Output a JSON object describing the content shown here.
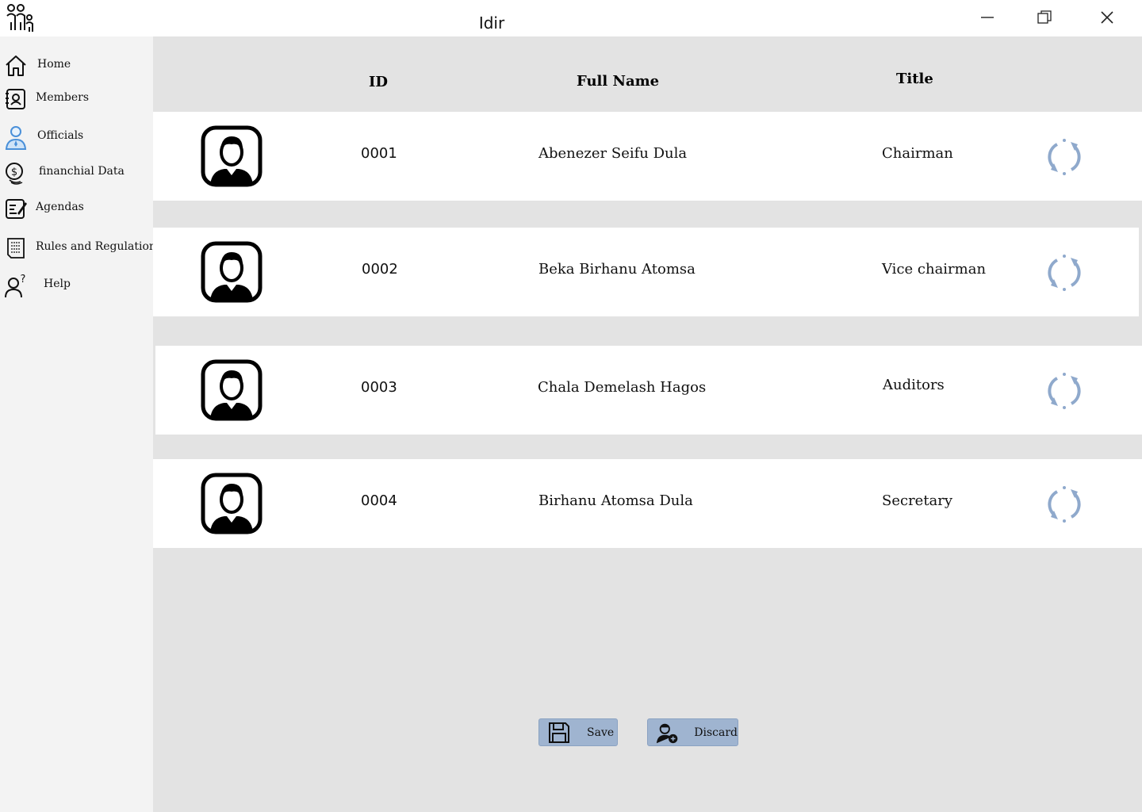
{
  "window": {
    "title": "Idir",
    "icons": {
      "logo": "family-icon",
      "minimize": "minimize-icon",
      "maximize": "maximize-icon",
      "close": "close-icon"
    }
  },
  "sidebar": {
    "items": [
      {
        "label": "Home",
        "icon": "home-icon"
      },
      {
        "label": "Members",
        "icon": "members-book-icon"
      },
      {
        "label": "Officials",
        "icon": "official-person-icon"
      },
      {
        "label": "financhial Data",
        "icon": "coins-icon"
      },
      {
        "label": "Agendas",
        "icon": "notepad-icon"
      },
      {
        "label": "Rules and Regulations",
        "icon": "document-icon"
      },
      {
        "label": "Help",
        "icon": "person-question-icon"
      }
    ]
  },
  "table": {
    "headers": {
      "id": "ID",
      "full_name": "Full Name",
      "title": "Title"
    },
    "rows": [
      {
        "id": "0001",
        "full_name": "Abenezer Seifu Dula",
        "title": "Chairman"
      },
      {
        "id": "0002",
        "full_name": "Beka Birhanu Atomsa",
        "title": "Vice chairman"
      },
      {
        "id": "0003",
        "full_name": "Chala Demelash Hagos",
        "title": "Auditors"
      },
      {
        "id": "0004",
        "full_name": "Birhanu Atomsa Dula",
        "title": "Secretary"
      }
    ],
    "row_icons": {
      "avatar": "user-avatar-icon",
      "action": "refresh-icon"
    }
  },
  "actions": {
    "save": {
      "label": "Save",
      "icon": "floppy-disk-icon"
    },
    "discard": {
      "label": "Discard",
      "icon": "user-add-icon"
    }
  },
  "colors": {
    "sidebar_bg": "#f3f3f3",
    "main_bg": "#e3e3e3",
    "row_bg": "#ffffff",
    "button_bg": "#9fb4d0",
    "refresh_icon": "#8fa9cc",
    "officials_icon": "#4a90d9"
  }
}
